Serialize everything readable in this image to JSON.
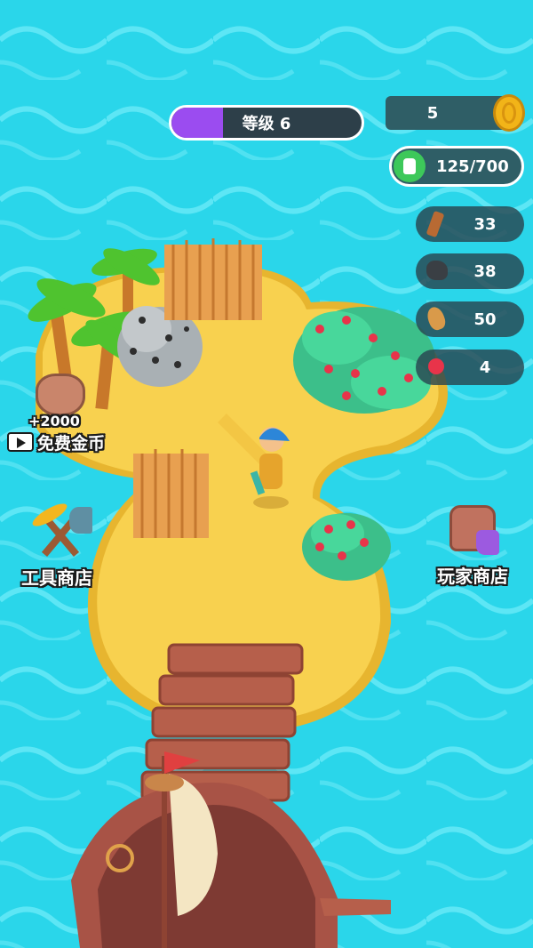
{
  "level": {
    "label": "等级 6",
    "progress": 0.27
  },
  "coins": {
    "value": "5"
  },
  "backpack": {
    "value": "125/700"
  },
  "resources": [
    {
      "name": "wood-icon",
      "value": "33"
    },
    {
      "name": "stone-icon",
      "value": "38"
    },
    {
      "name": "wheat-icon",
      "value": "50"
    },
    {
      "name": "berry-icon",
      "value": "4"
    }
  ],
  "free_coins": {
    "amount": "+2000",
    "label": "免费金币",
    "icon": "video-play-icon"
  },
  "tool_shop": {
    "label": "工具商店"
  },
  "player_shop": {
    "label": "玩家商店"
  },
  "colors": {
    "sea": "#2ad6ea",
    "sand": "#f7cf4d",
    "progress": "#9b4cf0",
    "coin": "#f2b418",
    "backpack": "#3dc85a"
  }
}
